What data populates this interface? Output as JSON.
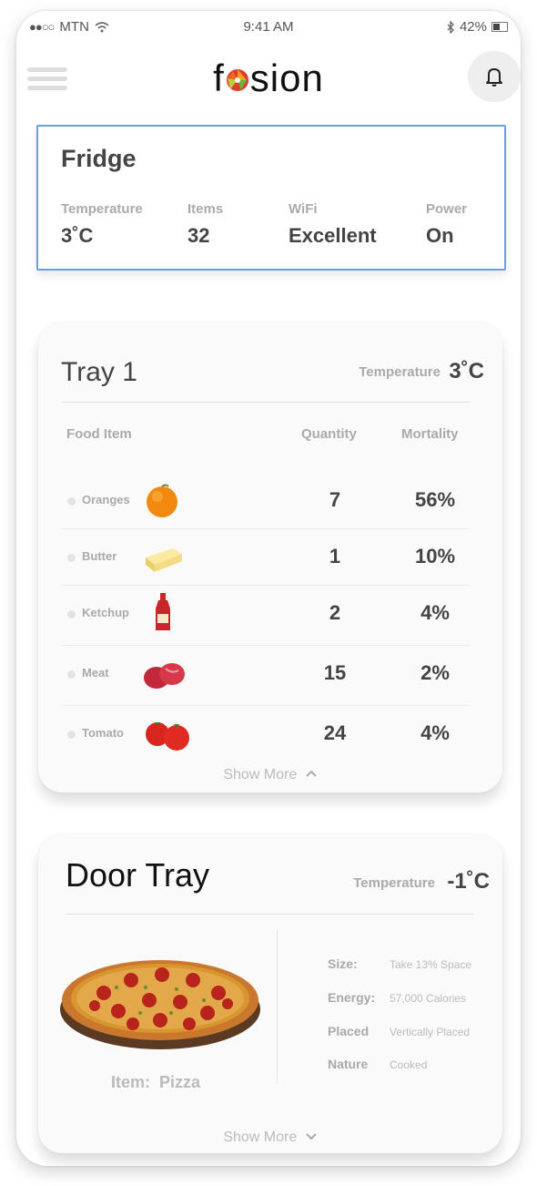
{
  "status_bar": {
    "signal_dots": "●●○○",
    "carrier": "MTN",
    "time": "9:41 AM",
    "battery": "42%"
  },
  "header": {
    "logo_text_before": "f",
    "logo_text_after": "sion",
    "bell_icon": "bell-icon",
    "menu_icon": "hamburger-icon"
  },
  "fridge": {
    "title": "Fridge",
    "stats": [
      {
        "label": "Temperature",
        "value": "3˚C"
      },
      {
        "label": "Items",
        "value": "32"
      },
      {
        "label": "WiFi",
        "value": "Excellent"
      },
      {
        "label": "Power",
        "value": "On"
      }
    ]
  },
  "tray": {
    "title": "Tray 1",
    "temp_label": "Temperature",
    "temp_value": "3˚C",
    "columns": {
      "item": "Food Item",
      "quantity": "Quantity",
      "mortality": "Mortality"
    },
    "rows": [
      {
        "name": "Oranges",
        "icon": "orange-icon",
        "quantity": "7",
        "mortality": "56%"
      },
      {
        "name": "Butter",
        "icon": "butter-icon",
        "quantity": "1",
        "mortality": "10%"
      },
      {
        "name": "Ketchup",
        "icon": "ketchup-icon",
        "quantity": "2",
        "mortality": "4%"
      },
      {
        "name": "Meat",
        "icon": "meat-icon",
        "quantity": "15",
        "mortality": "2%"
      },
      {
        "name": "Tomato",
        "icon": "tomato-icon",
        "quantity": "24",
        "mortality": "4%"
      }
    ],
    "show_more": "Show More"
  },
  "door_tray": {
    "title": "Door Tray",
    "temp_label": "Temperature",
    "temp_value": "-1˚C",
    "item_label": "Item:",
    "item_value": "Pizza",
    "specs": [
      {
        "key": "Size:",
        "value": "Take 13% Space"
      },
      {
        "key": "Energy:",
        "value": "57,000 Calories"
      },
      {
        "key": "Placed",
        "value": "Vertically Placed"
      },
      {
        "key": "Nature",
        "value": "Cooked"
      }
    ],
    "show_more": "Show More"
  }
}
